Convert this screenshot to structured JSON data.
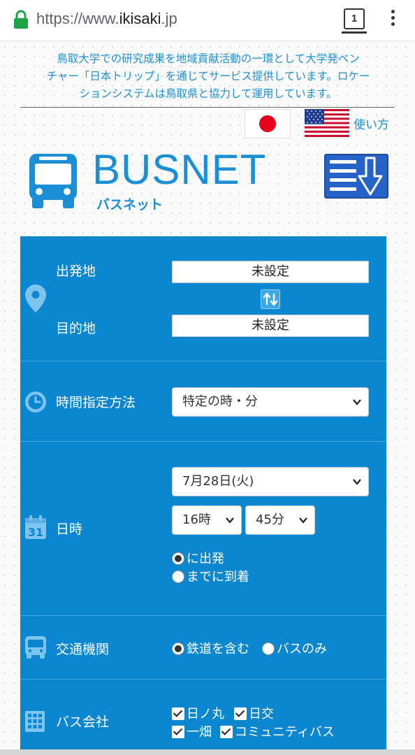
{
  "browser": {
    "url_prefix": "https://www.",
    "url_domain": "ikisaki",
    "url_suffix": ".jp",
    "tab_count": "1"
  },
  "notice": {
    "line1": "鳥取大学での研究成果を地域貢献活動の一環として大学発ベン",
    "line2": "チャー「日本トリップ」を通じてサービス提供しています。ロケー",
    "line3": "ションシステムは鳥取県と協力して運用しています。"
  },
  "lang": {
    "japanese_flag": "japan-flag",
    "english_flag": "us-flag",
    "help_link": "使い方"
  },
  "logo": {
    "title": "BUSNET",
    "kana": "バスネット"
  },
  "form": {
    "origin_label": "出発地",
    "origin_value": "未設定",
    "destination_label": "目的地",
    "destination_value": "未設定",
    "time_method_label": "時間指定方法",
    "time_method_value": "特定の時・分",
    "datetime_label": "日時",
    "date_value": "7月28日(火)",
    "hour_value": "16時",
    "minute_value": "45分",
    "depart_label": "に出発",
    "arrive_label": "までに到着",
    "depart_selected": true,
    "transport_label": "交通機関",
    "include_rail_label": "鉄道を含む",
    "bus_only_label": "バスのみ",
    "include_rail_selected": true,
    "company_label": "バス会社",
    "companies": [
      "日ノ丸",
      "日交",
      "一畑",
      "コミュニティバス"
    ],
    "calendar_day": "31"
  },
  "colors": {
    "brand_blue": "#1a8fd6",
    "panel_blue": "#0b86d1",
    "menu_button_blue": "#2563c9"
  }
}
